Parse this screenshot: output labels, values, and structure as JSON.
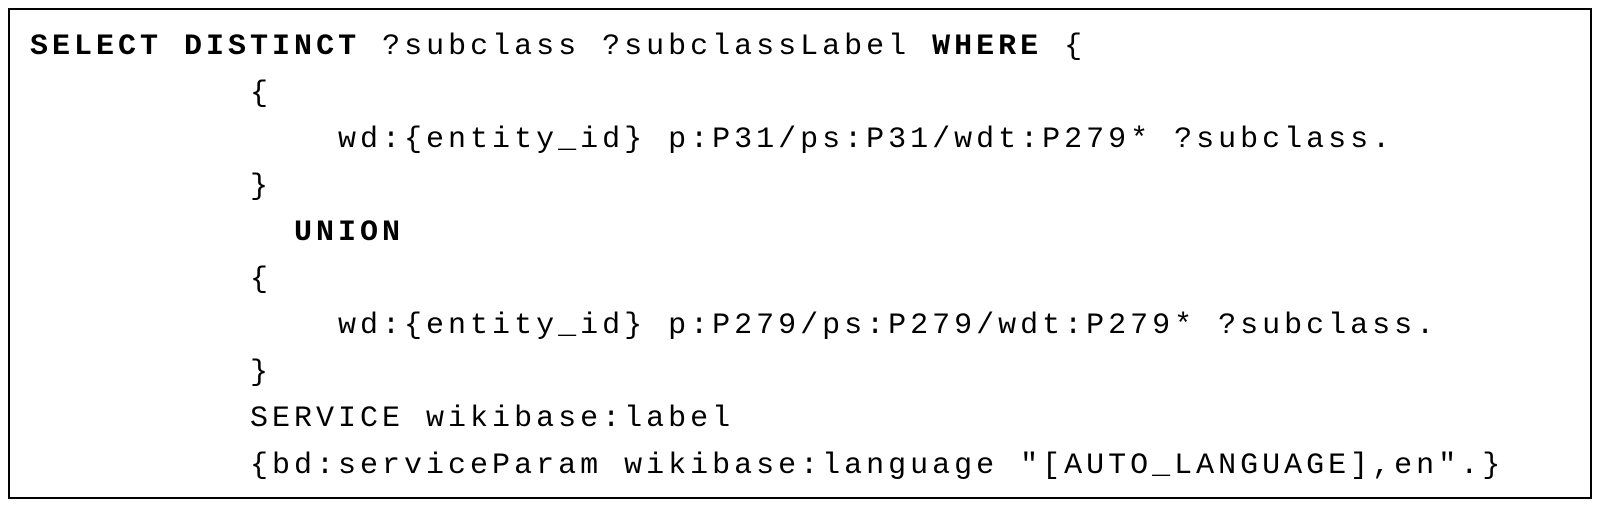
{
  "code": {
    "line1": {
      "select": "SELECT",
      "distinct": "DISTINCT",
      "vars": " ?subclass ?subclassLabel ",
      "where": "WHERE",
      "brace": " {"
    },
    "line2": "          {",
    "line3": "              wd:{entity_id} p:P31/ps:P31/wdt:P279* ?subclass.",
    "line4": "          }",
    "line5_indent": "            ",
    "line5_union": "UNION",
    "line6": "          {",
    "line7": "              wd:{entity_id} p:P279/ps:P279/wdt:P279* ?subclass.",
    "line8": "          }",
    "line9": "          SERVICE wikibase:label",
    "line10": "          {bd:serviceParam wikibase:language \"[AUTO_LANGUAGE],en\".}"
  }
}
